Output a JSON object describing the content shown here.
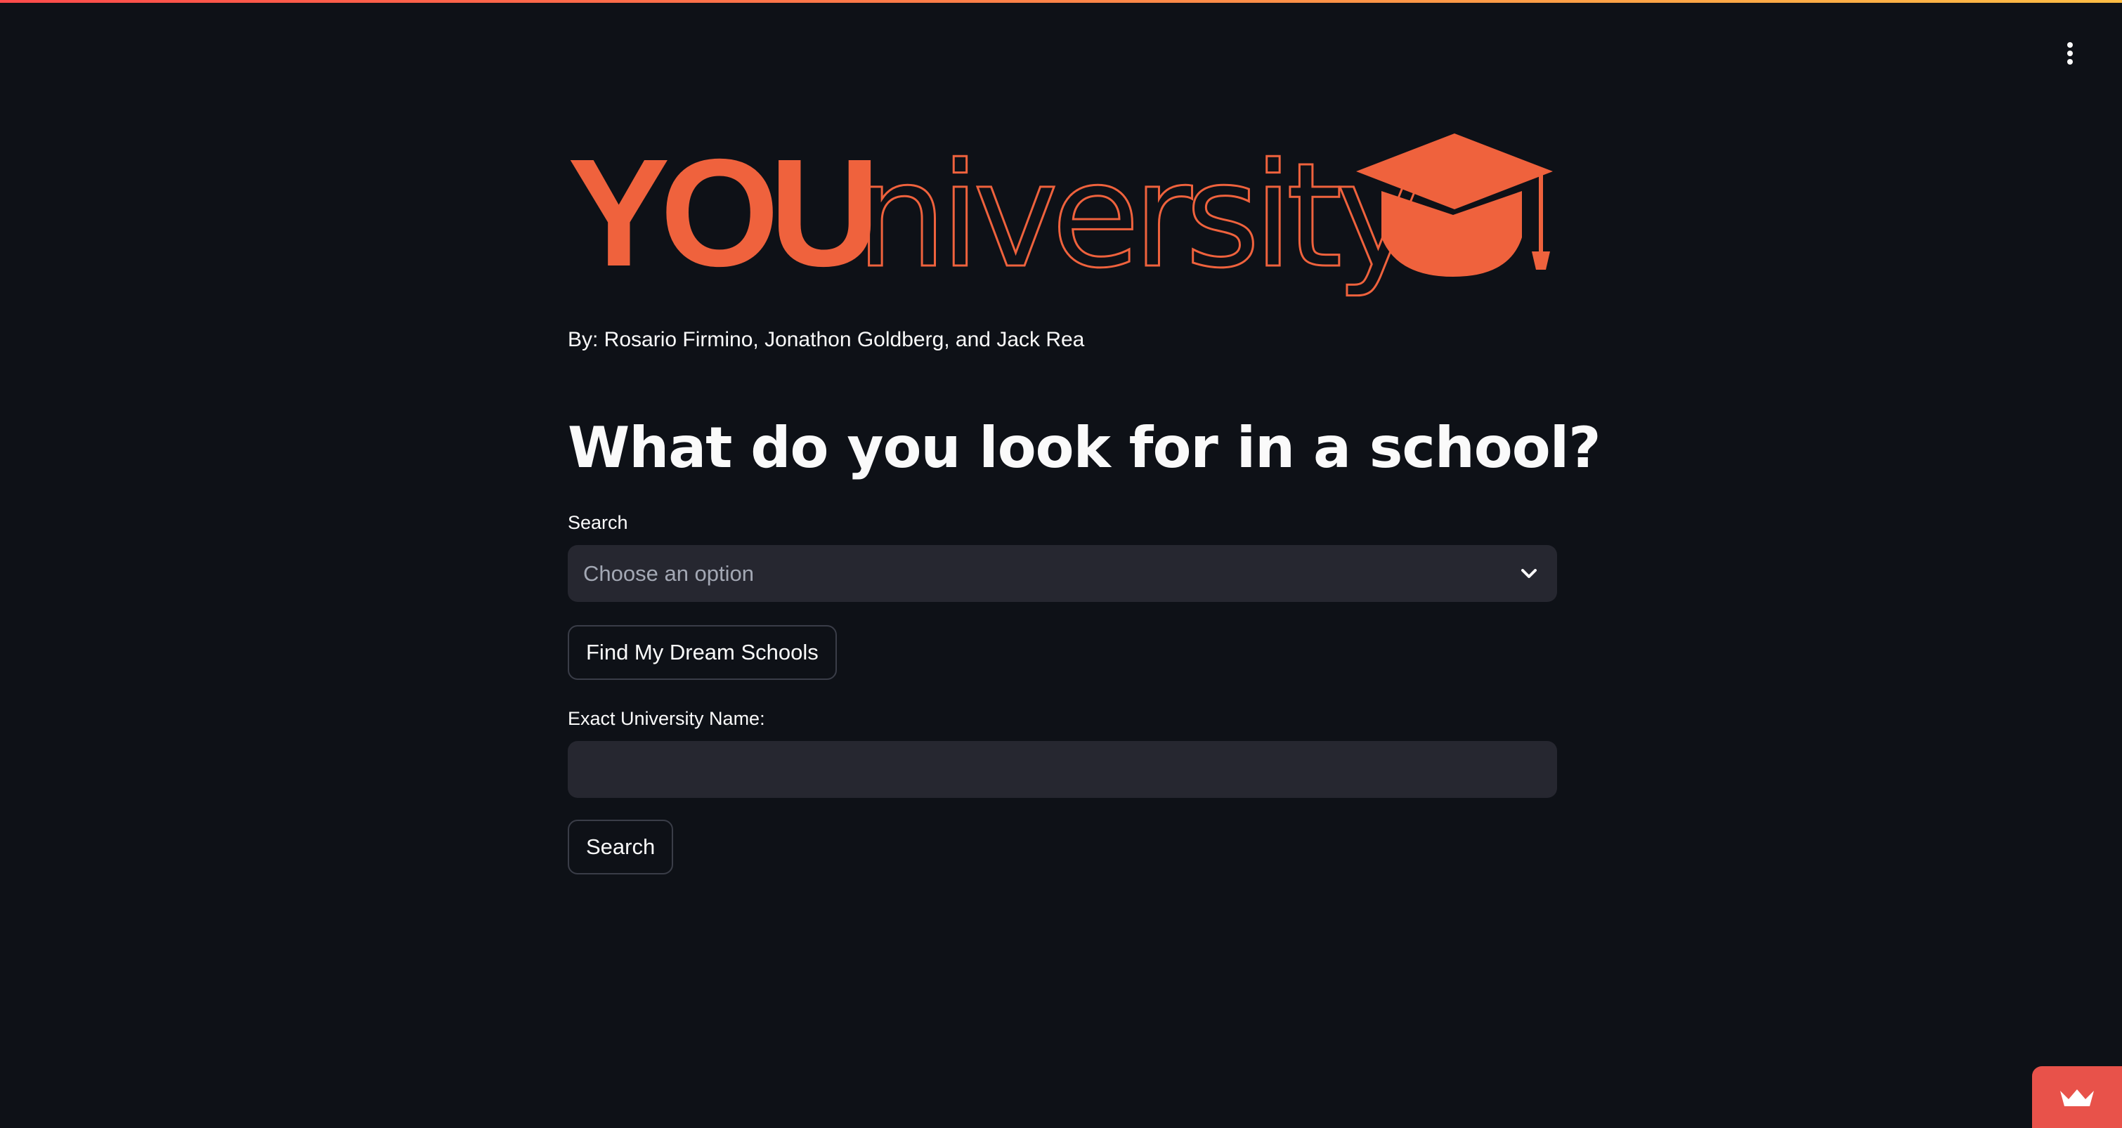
{
  "header": {
    "menu_icon": "vertical-dots-icon",
    "decoration_colors": [
      "#ff4b4b",
      "#ffbd45"
    ]
  },
  "logo": {
    "text_bold": "YOU",
    "text_light": "niversity",
    "icon": "graduation-cap-icon",
    "color": "#ef623d"
  },
  "byline": "By: Rosario Firmino, Jonathon Goldberg, and Jack Rea",
  "heading": "What do you look for in a school?",
  "search": {
    "label": "Search",
    "placeholder": "Choose an option",
    "icon": "chevron-down-icon"
  },
  "find_button": {
    "label": "Find My Dream Schools"
  },
  "university_name": {
    "label": "Exact University Name:",
    "value": ""
  },
  "search_button": {
    "label": "Search"
  },
  "badge": {
    "icon": "crown-icon",
    "color": "#e8524a"
  }
}
